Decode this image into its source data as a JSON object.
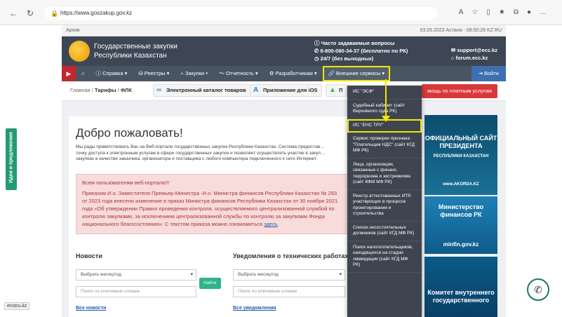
{
  "browser": {
    "url": "https://www.goszakup.gov.kz",
    "icons": [
      "back-icon",
      "refresh-icon",
      "home-icon"
    ]
  },
  "topstrip": {
    "left": "Архив",
    "right": "03.05.2023    Астана - 08:50:28    KZ    RU"
  },
  "header": {
    "brand_line1": "Государственные закупки",
    "brand_line2": "Республики Казахстан",
    "faq": "Часто задаваемые вопросы",
    "phone": "8-800-080-34-37 (бесплатно по РК)",
    "hours": "24/7 (без выходных)",
    "email": "support@ecc.kz",
    "forum": "forum.ecc.kz"
  },
  "menu": {
    "items": [
      "Справка ▾",
      "Реестры ▾",
      "Закупки ▾",
      "Отчетность ▾",
      "Разработчикам ▾",
      "Внешние сервисы ▾"
    ],
    "login": "Войти"
  },
  "subbar": {
    "crumb_home": "Главная",
    "crumb_tariffs": "Тарифы",
    "crumb_flk": "ФЛК",
    "catalog": "Электронный каталог товаров",
    "ios": "Приложение для iOS",
    "android": "П",
    "paid_help": "мощь по платным услугам"
  },
  "main": {
    "welcome": "Добро пожаловать!",
    "intro": "Мы рады приветствовать Вас на Веб-портале государственных закупок Республики Казахстан. Система предостав… точку доступа к электронным услугам в сфере государственных закупок и позволяет осуществлять участие в закуп… закупках в качестве заказчика, организатора и поставщика с любого компьютера подключенного к сети Интернет.",
    "notice_title": "Всем пользователям веб-портала!!!",
    "notice_text": "Приказом И.о. Заместителя Премьер-Министра -И.о. Министра финансов Республики Казахстан № 293 от 2023 года внесено изменение в приказ Министра финансов Республики Казахстан от 30 ноября 2021 года «Об утверждении Правил проведения контроля, осуществляемого централизованной службой по контролю закупками, за исключением централизованной службы по контролю за закупками Фонда национального благосостояния»: С текстом приказа можно ознакомиться",
    "notice_link": "здесь",
    "news_title": "Новости",
    "tech_title": "Уведомления о технических работах",
    "select_placeholder": "Выбрать месяц/год",
    "search_placeholder": "Поиск по ключевым словам",
    "find_btn": "Найти",
    "all_news": "Все новости",
    "all_tech": "Все уведомления"
  },
  "dropdown": {
    "items": [
      "ИС \"ЭСФ\"",
      "Судебный кабинет (сайт Верховного суда РК)",
      "ИС \"ЕНС ТРУ\"",
      "Сервис проверки признака \"Плательщик НДС\" (сайт КГД МФ РК)",
      "Лица, организации, связанные с финанс. терроризма и экстремизма (сайт КФМ МФ РК)",
      "Реестр аттестованных ИТР, участвующих в процессе проектирования и строительства",
      "Списки несостоятельных должников (сайт КГД МФ РК)",
      "Поиск налогоплательщиков, находящихся на стадии ликвидации (сайт КГД МФ РК)"
    ]
  },
  "banners": {
    "b1_title": "ОФИЦИАЛЬНЫЙ САЙТ ПРЕЗИДЕНТА",
    "b1_sub": "РЕСПУБЛИКИ КАЗАХСТАН",
    "b1_url": "www.AKORDA.KZ",
    "b2_title": "Министерство финансов РК",
    "b2_url": "minfin.gov.kz",
    "b3_title": "Комитет внутреннего государственного"
  },
  "sidetab": "Идеи и предложения",
  "status": "enstru.kz"
}
